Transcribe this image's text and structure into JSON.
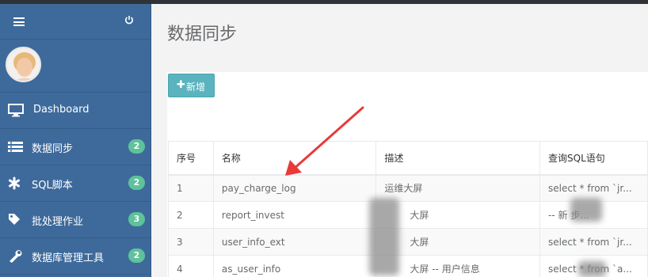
{
  "page": {
    "title": "数据同步"
  },
  "sidebar": {
    "menu_icon": "hamburger-menu-icon",
    "power_icon": "power-icon",
    "items": [
      {
        "label": "Dashboard",
        "icon": "monitor-icon",
        "badge": null
      },
      {
        "label": "数据同步",
        "icon": "list-bars-icon",
        "badge": "2"
      },
      {
        "label": "SQL脚本",
        "icon": "asterisk-icon",
        "badge": "2"
      },
      {
        "label": "批处理作业",
        "icon": "tag-icon",
        "badge": "3"
      },
      {
        "label": "数据库管理工具",
        "icon": "wrench-icon",
        "badge": "2"
      }
    ]
  },
  "toolbar": {
    "add_label": "新增"
  },
  "table": {
    "headers": [
      "序号",
      "名称",
      "描述",
      "查询SQL语句"
    ],
    "rows": [
      [
        "1",
        "pay_charge_log",
        "运维大屏",
        "select * from `jr..."
      ],
      [
        "2",
        "report_invest",
        "大屏",
        "-- 新 步..."
      ],
      [
        "3",
        "user_info_ext",
        "大屏",
        "select * from `jr..."
      ],
      [
        "4",
        "as_user_info",
        "大屏 -- 用户信息",
        "select * from `a..."
      ]
    ]
  },
  "colors": {
    "sidebar": "#3e6a9b",
    "badge": "#5ec29a",
    "add_button": "#5bb3bf",
    "annotation_arrow": "#e83a3a"
  }
}
